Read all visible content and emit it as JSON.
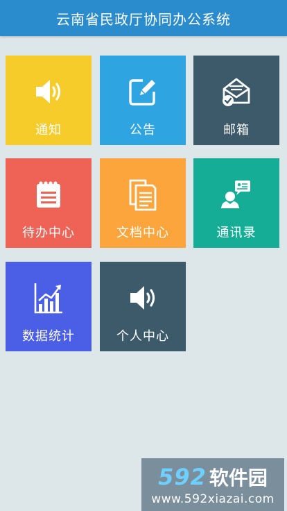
{
  "header": {
    "title": "云南省民政厅协同办公系统",
    "color": "#2a8bcd"
  },
  "tiles": [
    {
      "label": "通知",
      "icon": "speaker-icon",
      "color": "#f6cc2b"
    },
    {
      "label": "公告",
      "icon": "edit-icon",
      "color": "#2ea5e1"
    },
    {
      "label": "邮箱",
      "icon": "mail-icon",
      "color": "#3c5a6a"
    },
    {
      "label": "待办中心",
      "icon": "notepad-icon",
      "color": "#ee6355"
    },
    {
      "label": "文档中心",
      "icon": "document-icon",
      "color": "#fba53c"
    },
    {
      "label": "通讯录",
      "icon": "contact-icon",
      "color": "#15ad95"
    },
    {
      "label": "数据统计",
      "icon": "chart-icon",
      "color": "#4a5fe6"
    },
    {
      "label": "个人中心",
      "icon": "speaker-icon",
      "color": "#3c5a6a"
    }
  ],
  "watermark": {
    "brand_number": "592",
    "brand_text": "软件园",
    "url": "www.592xiazai.com"
  }
}
